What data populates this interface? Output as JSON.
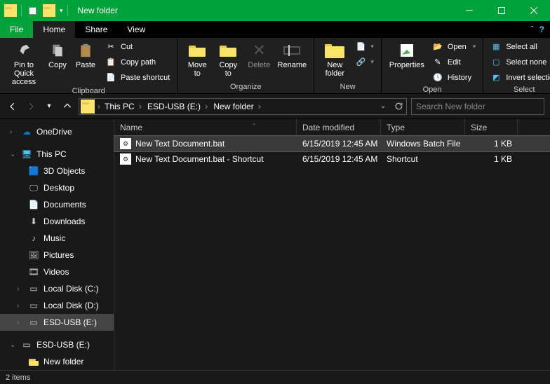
{
  "title": "New folder",
  "tabs": {
    "file": "File",
    "home": "Home",
    "share": "Share",
    "view": "View"
  },
  "ribbon": {
    "clipboard": {
      "label": "Clipboard",
      "pin": "Pin to Quick\naccess",
      "copy": "Copy",
      "paste": "Paste",
      "cut": "Cut",
      "copypath": "Copy path",
      "pasteshort": "Paste shortcut"
    },
    "organize": {
      "label": "Organize",
      "moveto": "Move\nto",
      "copyto": "Copy\nto",
      "delete": "Delete",
      "rename": "Rename"
    },
    "new": {
      "label": "New",
      "newfolder": "New\nfolder"
    },
    "open": {
      "label": "Open",
      "properties": "Properties",
      "open": "Open",
      "edit": "Edit",
      "history": "History"
    },
    "select": {
      "label": "Select",
      "all": "Select all",
      "none": "Select none",
      "invert": "Invert selection"
    }
  },
  "breadcrumbs": [
    "This PC",
    "ESD-USB (E:)",
    "New folder"
  ],
  "search_placeholder": "Search New folder",
  "tree": {
    "onedrive": "OneDrive",
    "thispc": "This PC",
    "items": [
      "3D Objects",
      "Desktop",
      "Documents",
      "Downloads",
      "Music",
      "Pictures",
      "Videos",
      "Local Disk (C:)",
      "Local Disk (D:)",
      "ESD-USB (E:)"
    ],
    "esd": "ESD-USB (E:)",
    "newfolder": "New folder"
  },
  "columns": {
    "name": "Name",
    "date": "Date modified",
    "type": "Type",
    "size": "Size"
  },
  "rows": [
    {
      "name": "New Text Document.bat",
      "date": "6/15/2019 12:45 AM",
      "type": "Windows Batch File",
      "size": "1 KB",
      "selected": true
    },
    {
      "name": "New Text Document.bat - Shortcut",
      "date": "6/15/2019 12:45 AM",
      "type": "Shortcut",
      "size": "1 KB",
      "selected": false
    }
  ],
  "status": "2 items"
}
